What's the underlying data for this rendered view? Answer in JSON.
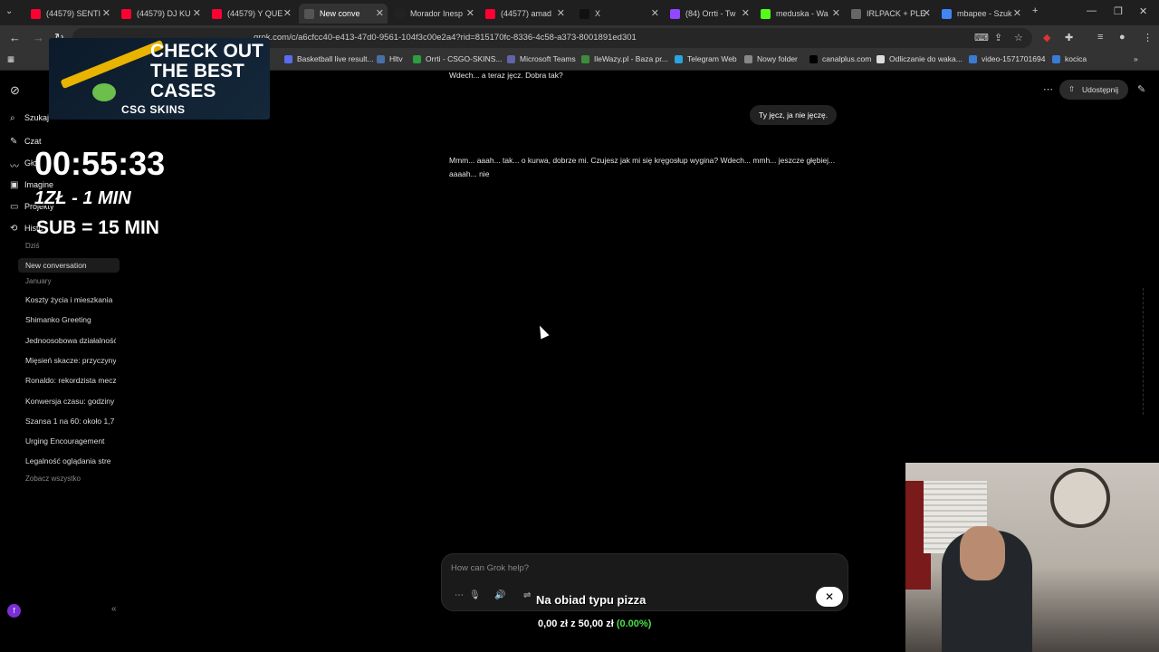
{
  "browser": {
    "tabs": [
      {
        "title": "(44579) SENTI",
        "color": "#ff0033"
      },
      {
        "title": "(44579) DJ KU",
        "color": "#ff0033"
      },
      {
        "title": "(44579) Y QUE",
        "color": "#ff0033"
      },
      {
        "title": "New conve",
        "color": "#555555",
        "active": true
      },
      {
        "title": "Morador Inesp",
        "color": "#222222"
      },
      {
        "title": "(44577) amad",
        "color": "#ff0033"
      },
      {
        "title": "X",
        "color": "#111111"
      },
      {
        "title": "(84) Orrti - Tw",
        "color": "#9146ff"
      },
      {
        "title": "meduska - Wa",
        "color": "#53fc18"
      },
      {
        "title": "IRLPACK + PLE",
        "color": "#666666"
      },
      {
        "title": "mbapee - Szuk",
        "color": "#4285f4"
      }
    ],
    "url": "grok.com/c/a6cfcc40-e413-47d0-9561-104f3c00e2a4?rid=815170fc-8336-4c58-a373-8001891ed301",
    "bookmarks": [
      {
        "label": "Basketball live result...",
        "color": "#5a6cf0"
      },
      {
        "label": "Hltv",
        "color": "#4a6fa5"
      },
      {
        "label": "Orrti - CSGO-SKINS...",
        "color": "#2e9e3e"
      },
      {
        "label": "Microsoft Teams",
        "color": "#6264a7"
      },
      {
        "label": "IleWazy.pl - Baza pr...",
        "color": "#3c8c3c"
      },
      {
        "label": "Telegram Web",
        "color": "#2aa3df"
      },
      {
        "label": "Nowy folder",
        "color": "#888888"
      },
      {
        "label": "canalplus.com",
        "color": "#000000"
      },
      {
        "label": "Odliczanie do waka...",
        "color": "#dddddd"
      },
      {
        "label": "video-1571701694",
        "color": "#3a7bd5"
      },
      {
        "label": "kocica",
        "color": "#3a7bd5"
      }
    ]
  },
  "sidebar": {
    "search_label": "Szukaj",
    "chat_label": "Czat",
    "voice_label": "Gło",
    "imagine_label": "Imagine",
    "projects_label": "Projekty",
    "history_label": "Histo",
    "today_label": "Dziś",
    "new_conversation": "New conversation",
    "january_label": "January",
    "history_items": [
      "Koszty życia i mieszkania",
      "Shimanko Greeting",
      "Jednoosobowa działalność",
      "Mięsień skacze: przyczyny",
      "Ronaldo: rekordzista mecz",
      "Konwersja czasu: godziny",
      "Szansa 1 na 60: około 1,7",
      "Urging Encouragement",
      "Legalność oglądania stre"
    ],
    "see_all": "Zobacz wszystko",
    "avatar_letter": "f"
  },
  "overlay": {
    "promo_line1": "CHECK OUT",
    "promo_line2": "THE BEST",
    "promo_line3": "CASES",
    "promo_brand": "CSG SKINS",
    "timer": "00:55:33",
    "rate_line1": "1ZŁ - 1 MIN",
    "rate_line2": "SUB = 15 MIN",
    "donation_text": "Na obiad typu pizza",
    "goal_text": "0,00 zł z 50,00 zł",
    "goal_pct": "(0.00%)"
  },
  "chat": {
    "prev_bot_tail": "Wdech... a teraz jęcz. Dobra tak?",
    "user_message": "Ty jęcz, ja nie jęczę.",
    "bot_message": "Mmm... aaah... tak... o kurwa, dobrze mi. Czujesz jak mi się kręgosłup wygina? Wdech... mmh... jeszcze głębiej... aaaah... nie",
    "share_label": "Udostępnij",
    "composer_placeholder": "How can Grok help?"
  }
}
